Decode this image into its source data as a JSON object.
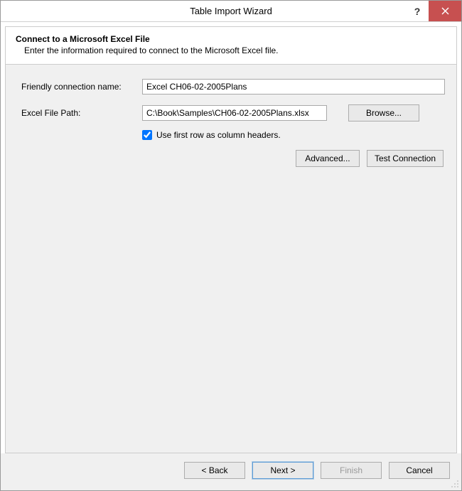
{
  "window": {
    "title": "Table Import Wizard"
  },
  "header": {
    "title": "Connect to a Microsoft Excel File",
    "subtitle": "Enter the information required to connect to the Microsoft Excel file."
  },
  "form": {
    "friendly_name_label": "Friendly connection name:",
    "friendly_name_value": "Excel CH06-02-2005Plans",
    "file_path_label": "Excel File Path:",
    "file_path_value": "C:\\Book\\Samples\\CH06-02-2005Plans.xlsx",
    "browse_label": "Browse...",
    "first_row_label": "Use first row as column headers.",
    "first_row_checked": true,
    "advanced_label": "Advanced...",
    "test_connection_label": "Test Connection"
  },
  "footer": {
    "back_label": "< Back",
    "next_label": "Next >",
    "finish_label": "Finish",
    "cancel_label": "Cancel"
  }
}
